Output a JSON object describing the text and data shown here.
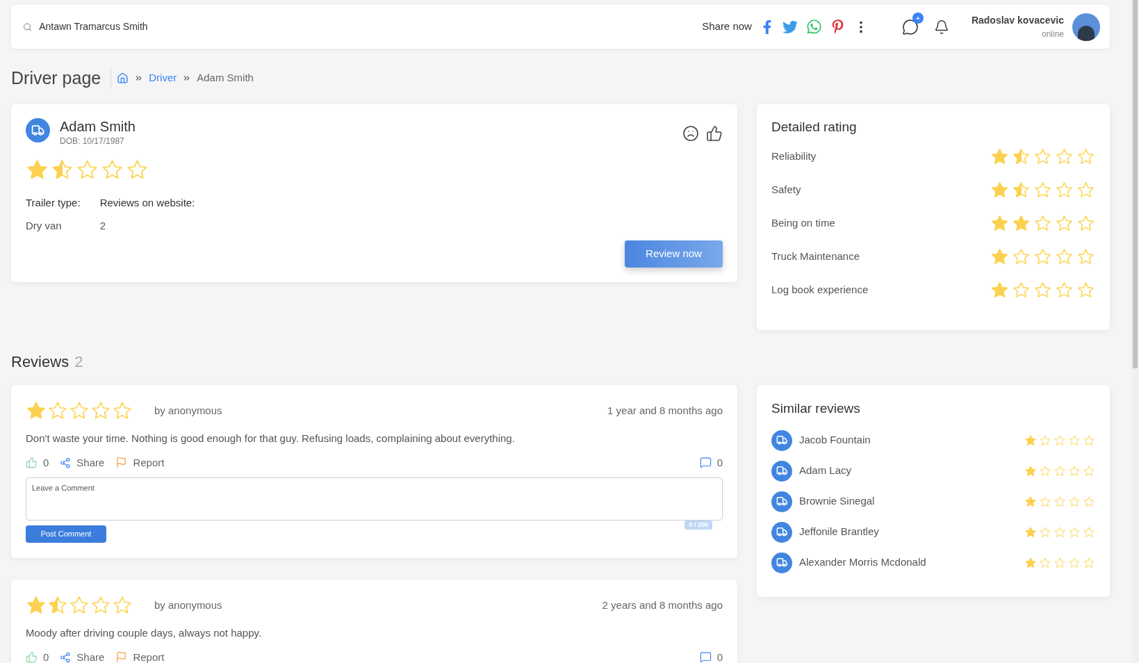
{
  "search": {
    "value": "Antawn Tramarcus Smith"
  },
  "header": {
    "share_label": "Share now",
    "notification_badge": "+",
    "user": {
      "name": "Radoslav kovacevic",
      "status": "online"
    }
  },
  "page": {
    "title": "Driver page",
    "breadcrumbs": [
      {
        "label": "Driver",
        "kind": "link"
      },
      {
        "label": "Adam Smith",
        "kind": "current"
      }
    ]
  },
  "driver": {
    "name": "Adam Smith",
    "dob": "DOB: 10/17/1987",
    "stars": 1.5,
    "fields": [
      {
        "label": "Trailer type:",
        "value": "Dry van"
      },
      {
        "label": "Reviews on website:",
        "value": "2"
      }
    ],
    "button": "Review now"
  },
  "detailed_rating": {
    "title": "Detailed rating",
    "items": [
      {
        "label": "Reliability",
        "stars": 1.5
      },
      {
        "label": "Safety",
        "stars": 1.5
      },
      {
        "label": "Being on time",
        "stars": 2
      },
      {
        "label": "Truck Maintenance",
        "stars": 1
      },
      {
        "label": "Log book experience",
        "stars": 1
      }
    ]
  },
  "reviews": {
    "title": "Reviews",
    "count": "2",
    "items": [
      {
        "stars": 1,
        "author": "by anonymous",
        "time": "1 year and 8 months ago",
        "text": "Don't waste your time. Nothing is good enough for that guy. Refusing loads, complaining about everything.",
        "likes": "0",
        "share": "Share",
        "report": "Report",
        "comments": "0",
        "comment_box": {
          "placeholder": "Leave a Comment",
          "counter": "0 / 200",
          "button": "Post Comment"
        }
      },
      {
        "stars": 1.5,
        "author": "by anonymous",
        "time": "2 years and 8 months ago",
        "text": "Moody after driving couple days, always not happy.",
        "likes": "0",
        "share": "Share",
        "report": "Report",
        "comments": "0"
      }
    ]
  },
  "similar": {
    "title": "Similar reviews",
    "items": [
      {
        "name": "Jacob Fountain",
        "stars": 1
      },
      {
        "name": "Adam Lacy",
        "stars": 1
      },
      {
        "name": "Brownie Sinegal",
        "stars": 1
      },
      {
        "name": "Jeffonile Brantley",
        "stars": 1
      },
      {
        "name": "Alexander Morris Mcdonald",
        "stars": 1
      }
    ]
  }
}
